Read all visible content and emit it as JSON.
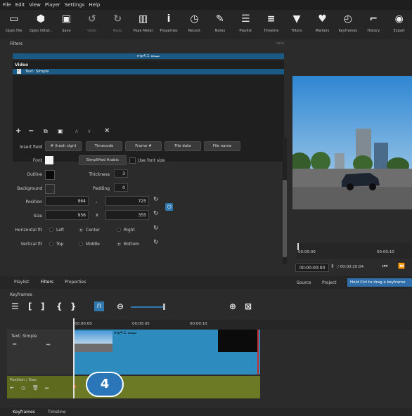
{
  "menu": [
    "File",
    "Edit",
    "View",
    "Player",
    "Settings",
    "Help"
  ],
  "toolbar": [
    {
      "label": "Open File",
      "icon": "folder-icon",
      "glyph": "▭"
    },
    {
      "label": "Open Other..",
      "icon": "open-other-icon",
      "glyph": "⬢"
    },
    {
      "label": "Save",
      "icon": "save-icon",
      "glyph": "▣"
    },
    {
      "label": "Undo",
      "icon": "undo-icon",
      "glyph": "↺"
    },
    {
      "label": "Redo",
      "icon": "redo-icon",
      "glyph": "↻"
    },
    {
      "label": "Peak Meter",
      "icon": "peak-meter-icon",
      "glyph": "▥"
    },
    {
      "label": "Properties",
      "icon": "info-icon",
      "glyph": "i"
    },
    {
      "label": "Recent",
      "icon": "clock-icon",
      "glyph": "◷"
    },
    {
      "label": "Notes",
      "icon": "notes-icon",
      "glyph": "✎"
    },
    {
      "label": "Playlist",
      "icon": "list-icon",
      "glyph": "☰"
    },
    {
      "label": "Timeline",
      "icon": "timeline-icon",
      "glyph": "≡"
    },
    {
      "label": "Filters",
      "icon": "filter-icon",
      "glyph": "▼"
    },
    {
      "label": "Markers",
      "icon": "marker-icon",
      "glyph": "♥"
    },
    {
      "label": "Keyframes",
      "icon": "stopwatch-icon",
      "glyph": "◴"
    },
    {
      "label": "History",
      "icon": "history-icon",
      "glyph": "⌐"
    },
    {
      "label": "Export",
      "icon": "export-icon",
      "glyph": "◉"
    }
  ],
  "filters": {
    "header": "Filters",
    "clip_name": "mp4.1 نسخة",
    "section": "Video",
    "item": "Text: Simple",
    "insert_field_label": "Insert field",
    "insert_buttons": [
      "# (hash sign)",
      "Timecode",
      "Frame #",
      "File date",
      "File name"
    ],
    "font_label": "Font",
    "font_button": "Simplified Arabic",
    "use_font_size": "Use font size",
    "outline_label": "Outline",
    "thickness_label": "Thickness",
    "thickness_value": "3",
    "background_label": "Background",
    "padding_label": "Padding",
    "padding_value": "0",
    "position_label": "Position",
    "position_x": "964",
    "position_y": "725",
    "size_label": "Size",
    "size_w": "956",
    "size_h": "355",
    "hfit_label": "Horizontal fit",
    "hfit_options": [
      "Left",
      "Center",
      "Right"
    ],
    "vfit_label": "Vertical fit",
    "vfit_options": [
      "Top",
      "Middle",
      "Bottom"
    ],
    "comma": ",",
    "x": "x"
  },
  "bottom_tabs": [
    "Playlist",
    "Filters",
    "Properties"
  ],
  "player": {
    "timecode_current": "00:00:00:00",
    "timecode_total": "/ 00:00:20:04",
    "ruler_start": "00:00:00",
    "ruler_mid": "00:00:10",
    "tabs": [
      "Source",
      "Project"
    ],
    "hint": "Hold Ctrl to drag a keyframe"
  },
  "keyframes": {
    "header": "Keyframes",
    "ruler": [
      "00:00:00",
      "00:00:05",
      "00:00:10"
    ],
    "track1": "Text: Simple",
    "clip_label": "mp4.1 نسخة",
    "track2": "Position / Size",
    "badge": "4"
  },
  "footer_tabs": [
    "Keyframes",
    "Timeline"
  ]
}
